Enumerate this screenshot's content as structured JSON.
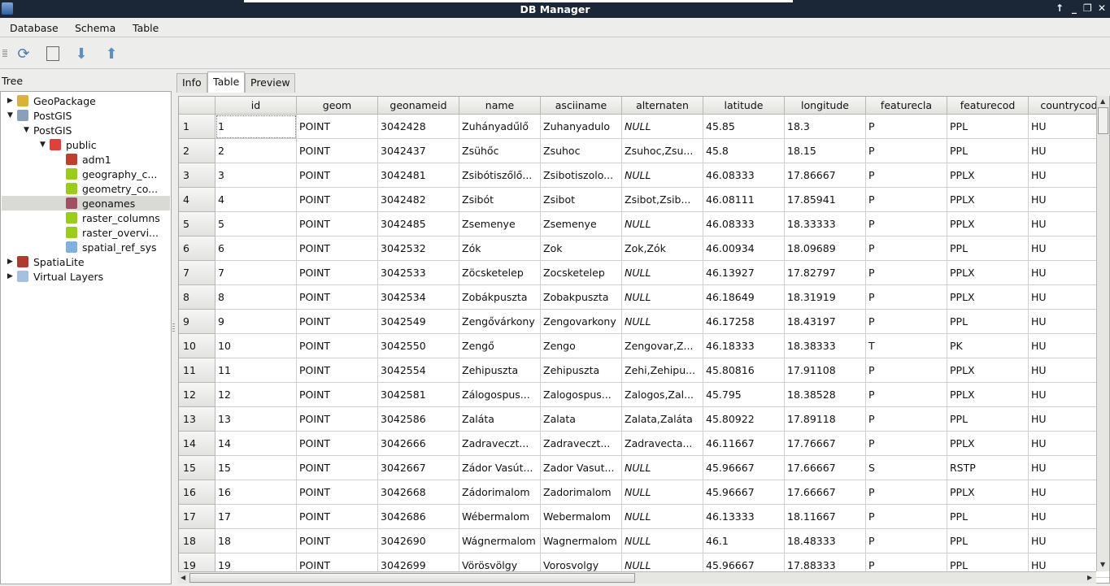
{
  "window": {
    "title": "DB Manager"
  },
  "menu": [
    "Database",
    "Schema",
    "Table"
  ],
  "toolbar": {
    "icons": [
      "refresh-icon",
      "sql-window-icon",
      "import-layer-icon",
      "export-layer-icon"
    ]
  },
  "tree": {
    "label": "Tree",
    "nodes": [
      {
        "label": "GeoPackage",
        "level": 0,
        "arrow": "▶",
        "icon": "geopackage-icon",
        "color": "#d9b23a"
      },
      {
        "label": "PostGIS",
        "level": 0,
        "arrow": "▼",
        "icon": "postgis-icon",
        "color": "#8aa0b8"
      },
      {
        "label": "PostGIS",
        "level": 1,
        "arrow": "▼",
        "icon": "",
        "color": ""
      },
      {
        "label": "public",
        "level": 2,
        "arrow": "▼",
        "icon": "schema-icon",
        "color": "#e0403a"
      },
      {
        "label": "adm1",
        "level": 3,
        "arrow": "",
        "icon": "polygon-layer-icon",
        "color": "#c04030"
      },
      {
        "label": "geography_c...",
        "level": 3,
        "arrow": "",
        "icon": "table-layer-icon",
        "color": "#9ccc1a"
      },
      {
        "label": "geometry_co...",
        "level": 3,
        "arrow": "",
        "icon": "table-layer-icon",
        "color": "#9ccc1a"
      },
      {
        "label": "geonames",
        "level": 3,
        "arrow": "",
        "icon": "point-layer-icon",
        "color": "#a05060",
        "selected": true
      },
      {
        "label": "raster_columns",
        "level": 3,
        "arrow": "",
        "icon": "table-layer-icon",
        "color": "#9ccc1a"
      },
      {
        "label": "raster_overvi...",
        "level": 3,
        "arrow": "",
        "icon": "table-layer-icon",
        "color": "#9ccc1a"
      },
      {
        "label": "spatial_ref_sys",
        "level": 3,
        "arrow": "",
        "icon": "plain-table-icon",
        "color": "#7fb0e0"
      },
      {
        "label": "SpatiaLite",
        "level": 0,
        "arrow": "▶",
        "icon": "spatialite-icon",
        "color": "#b03a30"
      },
      {
        "label": "Virtual Layers",
        "level": 0,
        "arrow": "▶",
        "icon": "virtual-layers-icon",
        "color": "#a8c0e0"
      }
    ]
  },
  "tabs": [
    {
      "label": "Info"
    },
    {
      "label": "Table",
      "active": true
    },
    {
      "label": "Preview"
    }
  ],
  "table": {
    "columns": [
      "id",
      "geom",
      "geonameid",
      "name",
      "asciiname",
      "alternaten",
      "latitude",
      "longitude",
      "featurecla",
      "featurecod",
      "countrycod"
    ],
    "rows": [
      [
        "1",
        "POINT",
        "3042428",
        "Zuhányadűlő",
        "Zuhanyadulo",
        "NULL",
        "45.85",
        "18.3",
        "P",
        "PPL",
        "HU"
      ],
      [
        "2",
        "POINT",
        "3042437",
        "Zsühőc",
        "Zsuhoc",
        "Zsuhoc,Zsu...",
        "45.8",
        "18.15",
        "P",
        "PPL",
        "HU"
      ],
      [
        "3",
        "POINT",
        "3042481",
        "Zsibótiszőlő...",
        "Zsibotiszolo...",
        "NULL",
        "46.08333",
        "17.86667",
        "P",
        "PPLX",
        "HU"
      ],
      [
        "4",
        "POINT",
        "3042482",
        "Zsibót",
        "Zsibot",
        "Zsibot,Zsib...",
        "46.08111",
        "17.85941",
        "P",
        "PPLX",
        "HU"
      ],
      [
        "5",
        "POINT",
        "3042485",
        "Zsemenye",
        "Zsemenye",
        "NULL",
        "46.08333",
        "18.33333",
        "P",
        "PPLX",
        "HU"
      ],
      [
        "6",
        "POINT",
        "3042532",
        "Zók",
        "Zok",
        "Zok,Zók",
        "46.00934",
        "18.09689",
        "P",
        "PPL",
        "HU"
      ],
      [
        "7",
        "POINT",
        "3042533",
        "Zöcsketelep",
        "Zocsketelep",
        "NULL",
        "46.13927",
        "17.82797",
        "P",
        "PPLX",
        "HU"
      ],
      [
        "8",
        "POINT",
        "3042534",
        "Zobákpuszta",
        "Zobakpuszta",
        "NULL",
        "46.18649",
        "18.31919",
        "P",
        "PPLX",
        "HU"
      ],
      [
        "9",
        "POINT",
        "3042549",
        "Zengővárkony",
        "Zengovarkony",
        "NULL",
        "46.17258",
        "18.43197",
        "P",
        "PPL",
        "HU"
      ],
      [
        "10",
        "POINT",
        "3042550",
        "Zengő",
        "Zengo",
        "Zengovar,Z...",
        "46.18333",
        "18.38333",
        "T",
        "PK",
        "HU"
      ],
      [
        "11",
        "POINT",
        "3042554",
        "Zehipuszta",
        "Zehipuszta",
        "Zehi,Zehipu...",
        "45.80816",
        "17.91108",
        "P",
        "PPLX",
        "HU"
      ],
      [
        "12",
        "POINT",
        "3042581",
        "Zálogospus...",
        "Zalogospus...",
        "Zalogos,Zal...",
        "45.795",
        "18.38528",
        "P",
        "PPLX",
        "HU"
      ],
      [
        "13",
        "POINT",
        "3042586",
        "Zaláta",
        "Zalata",
        "Zalata,Zaláta",
        "45.80922",
        "17.89118",
        "P",
        "PPL",
        "HU"
      ],
      [
        "14",
        "POINT",
        "3042666",
        "Zadraveczt...",
        "Zadraveczt...",
        "Zadravecta...",
        "46.11667",
        "17.76667",
        "P",
        "PPLX",
        "HU"
      ],
      [
        "15",
        "POINT",
        "3042667",
        "Zádor Vasút...",
        "Zador Vasut...",
        "NULL",
        "45.96667",
        "17.66667",
        "S",
        "RSTP",
        "HU"
      ],
      [
        "16",
        "POINT",
        "3042668",
        "Zádorimalom",
        "Zadorimalom",
        "NULL",
        "45.96667",
        "17.66667",
        "P",
        "PPLX",
        "HU"
      ],
      [
        "17",
        "POINT",
        "3042686",
        "Wébermalom",
        "Webermalom",
        "NULL",
        "46.13333",
        "18.11667",
        "P",
        "PPL",
        "HU"
      ],
      [
        "18",
        "POINT",
        "3042690",
        "Wágnermalom",
        "Wagnermalom",
        "NULL",
        "46.1",
        "18.48333",
        "P",
        "PPL",
        "HU"
      ],
      [
        "19",
        "POINT",
        "3042699",
        "Vörösvölgy",
        "Vorosvolgy",
        "NULL",
        "45.96667",
        "17.88333",
        "P",
        "PPL",
        "HU"
      ]
    ]
  }
}
